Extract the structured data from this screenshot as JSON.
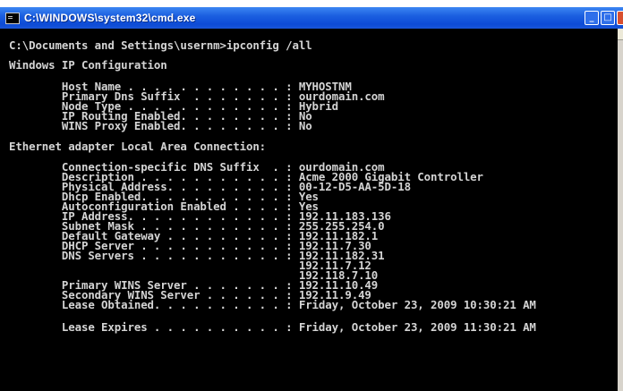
{
  "window": {
    "title": "C:\\WINDOWS\\system32\\cmd.exe"
  },
  "console": {
    "prompt_line": "C:\\Documents and Settings\\usernm>ipconfig /all",
    "heading": "Windows IP Configuration",
    "host_name": "        Host Name . . . . . . . . . . . . : MYHOSTNM",
    "primary_dns_suffix": "        Primary Dns Suffix  . . . . . . . : ourdomain.com",
    "node_type": "        Node Type . . . . . . . . . . . . : Hybrid",
    "ip_routing": "        IP Routing Enabled. . . . . . . . : No",
    "wins_proxy": "        WINS Proxy Enabled. . . . . . . . : No",
    "adapter_heading": "Ethernet adapter Local Area Connection:",
    "conn_dns_suffix": "        Connection-specific DNS Suffix  . : ourdomain.com",
    "description": "        Description . . . . . . . . . . . : Acme 2000 Gigabit Controller",
    "physical_address": "        Physical Address. . . . . . . . . : 00-12-D5-AA-5D-18",
    "dhcp_enabled": "        Dhcp Enabled. . . . . . . . . . . : Yes",
    "autoconfig": "        Autoconfiguration Enabled . . . . : Yes",
    "ip_address": "        IP Address. . . . . . . . . . . . : 192.11.183.136",
    "subnet_mask": "        Subnet Mask . . . . . . . . . . . : 255.255.254.0",
    "default_gateway": "        Default Gateway . . . . . . . . . : 192.11.182.1",
    "dhcp_server": "        DHCP Server . . . . . . . . . . . : 192.11.7.30",
    "dns_servers": "        DNS Servers . . . . . . . . . . . : 192.11.182.31",
    "dns_server_2": "                                            192.11.7.12",
    "dns_server_3": "                                            192.118.7.10",
    "primary_wins": "        Primary WINS Server . . . . . . . : 192.11.10.49",
    "secondary_wins": "        Secondary WINS Server . . . . . . : 192.11.9.49",
    "lease_obtained": "        Lease Obtained. . . . . . . . . . : Friday, October 23, 2009 10:30:21 AM",
    "lease_expires": "        Lease Expires . . . . . . . . . . : Friday, October 23, 2009 11:30:21 AM"
  },
  "icons": {
    "app": "cmd-icon",
    "minimize": "minimize-icon",
    "maximize": "maximize-icon",
    "close": "close-icon"
  },
  "colors": {
    "titlebar": "#0d4bd6",
    "console_bg": "#000000",
    "console_text": "#d4d4d4"
  }
}
